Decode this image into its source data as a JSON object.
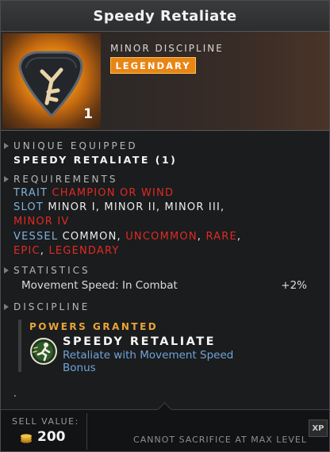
{
  "title": "Speedy Retaliate",
  "header": {
    "subtitle": "MINOR DISCIPLINE",
    "rarity": "LEGENDARY",
    "count": "1",
    "icon": "rune-shield-icon"
  },
  "unique": {
    "heading": "UNIQUE EQUIPPED",
    "value": "SPEEDY RETALIATE (1)"
  },
  "requirements": {
    "heading": "REQUIREMENTS",
    "trait_label": "TRAIT",
    "trait_value": "CHAMPION OR WIND",
    "slot_label": "SLOT",
    "slot_values": "MINOR I, MINOR II, MINOR III,",
    "slot_values_2": "MINOR IV",
    "vessel_label": "VESSEL",
    "vessel_common": "COMMON",
    "vessel_uncommon": "UNCOMMON",
    "vessel_rare": "RARE",
    "vessel_epic": "EPIC",
    "vessel_legendary": "LEGENDARY"
  },
  "statistics": {
    "heading": "STATISTICS",
    "rows": [
      {
        "label": "Movement Speed: In Combat",
        "value": "+2%"
      }
    ]
  },
  "discipline": {
    "heading": "DISCIPLINE",
    "powers_heading": "POWERS GRANTED",
    "power_name": "SPEEDY RETALIATE",
    "power_desc": "Retaliate with Movement Speed Bonus",
    "power_icon": "running-figure-icon",
    "trailing": "."
  },
  "footer": {
    "sell_label": "SELL VALUE:",
    "sell_value": "200",
    "coin_icon": "gold-coins-icon",
    "note": "CANNOT SACRIFICE AT MAX LEVEL",
    "xp": "XP"
  },
  "colors": {
    "legendary": "#e88514",
    "requirement_red": "#e02a24",
    "label_blue": "#7eb2dc",
    "power_gold": "#e9a43a"
  }
}
